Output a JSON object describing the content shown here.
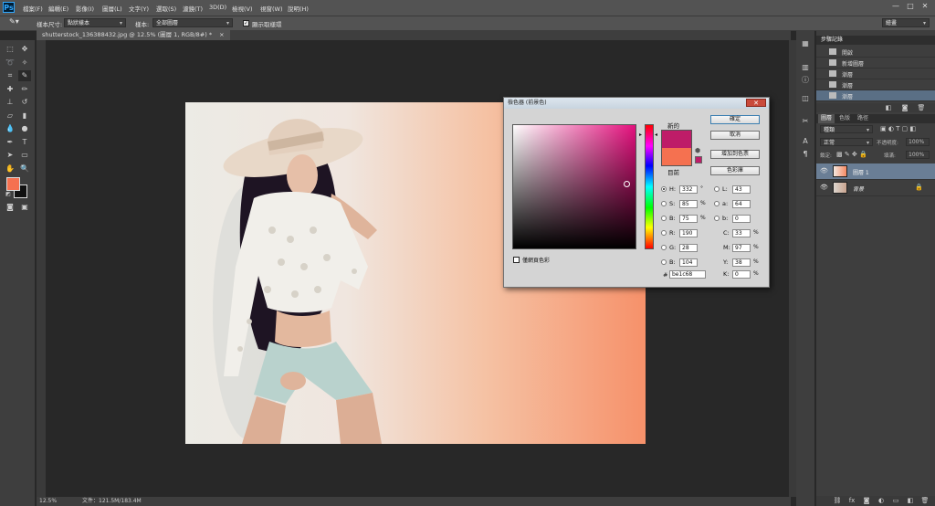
{
  "menubar": {
    "logo": "Ps",
    "items": [
      "檔案(F)",
      "編輯(E)",
      "影像(I)",
      "圖層(L)",
      "文字(Y)",
      "選取(S)",
      "濾鏡(T)",
      "3D(D)",
      "檢視(V)",
      "視窗(W)",
      "說明(H)"
    ],
    "win_controls": [
      "—",
      "□",
      "✕"
    ]
  },
  "options": {
    "sample_size_label": "樣本尺寸:",
    "sample_size_value": "點狀樣本",
    "sample_label": "樣本:",
    "sample_value": "全部圖層",
    "show_ring_label": "顯示取樣環",
    "workspace": "繪畫"
  },
  "document": {
    "tab_title": "shutterstock_136388432.jpg @ 12.5% (圖層 1, RGB/8#) *",
    "tab_close": "×"
  },
  "status": {
    "zoom": "12.5%",
    "doc_info": "文件：121.5M/183.4M"
  },
  "panels": {
    "history_tabs": [
      "步驟記錄"
    ],
    "history_items": [
      "開啟",
      "新增圖層",
      "漸層",
      "漸層",
      "漸層"
    ],
    "layers_tabs": [
      "圖層",
      "色版",
      "路徑"
    ],
    "kind_label": "種類",
    "blend_mode": "正常",
    "opacity_label": "不透明度:",
    "opacity_value": "100%",
    "lock_label": "鎖定:",
    "fill_label": "填滿:",
    "fill_value": "100%",
    "layers": [
      {
        "name": "圖層 1",
        "selected": true
      },
      {
        "name": "背景",
        "selected": false,
        "locked": true
      }
    ]
  },
  "picker": {
    "title": "檢色器 (前景色)",
    "close": "✕",
    "new_label": "新的",
    "current_label": "目前",
    "new_color": "#be1c68",
    "current_color": "#f57150",
    "ok": "確定",
    "cancel": "取消",
    "add_swatch": "增加到色票",
    "color_libraries": "色彩庫",
    "web_only": "僅網頁色彩",
    "fields": {
      "H": "332",
      "S": "85",
      "B": "75",
      "R": "190",
      "G": "28",
      "Bv": "104",
      "L": "43",
      "a": "64",
      "b": "0",
      "C": "33",
      "M": "97",
      "Y": "38",
      "K": "0",
      "hex": "be1c68"
    },
    "units": {
      "deg": "°",
      "pct": "%"
    }
  }
}
